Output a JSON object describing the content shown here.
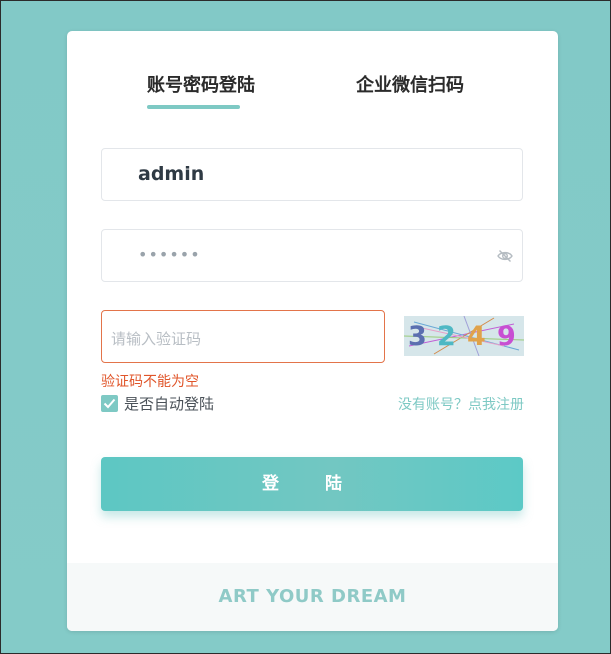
{
  "tabs": [
    {
      "label": "账号密码登陆",
      "active": true
    },
    {
      "label": "企业微信扫码",
      "active": false
    }
  ],
  "form": {
    "username_value": "admin",
    "password_mask": "••••••",
    "captcha_placeholder": "请输入验证码",
    "captcha_digits": [
      "3",
      "2",
      "4",
      "9"
    ],
    "captcha_error": "验证码不能为空",
    "remember_label": "是否自动登陆",
    "remember_checked": true,
    "register_link": "没有账号？点我注册",
    "login_button": "登 陆"
  },
  "footer": {
    "slogan": "ART YOUR DREAM"
  },
  "colors": {
    "accent": "#7ec9c4",
    "error": "#e0552a",
    "background": "#84cbc8"
  },
  "icons": {
    "password_toggle": "eye-slash-icon",
    "checkbox": "check-icon"
  }
}
